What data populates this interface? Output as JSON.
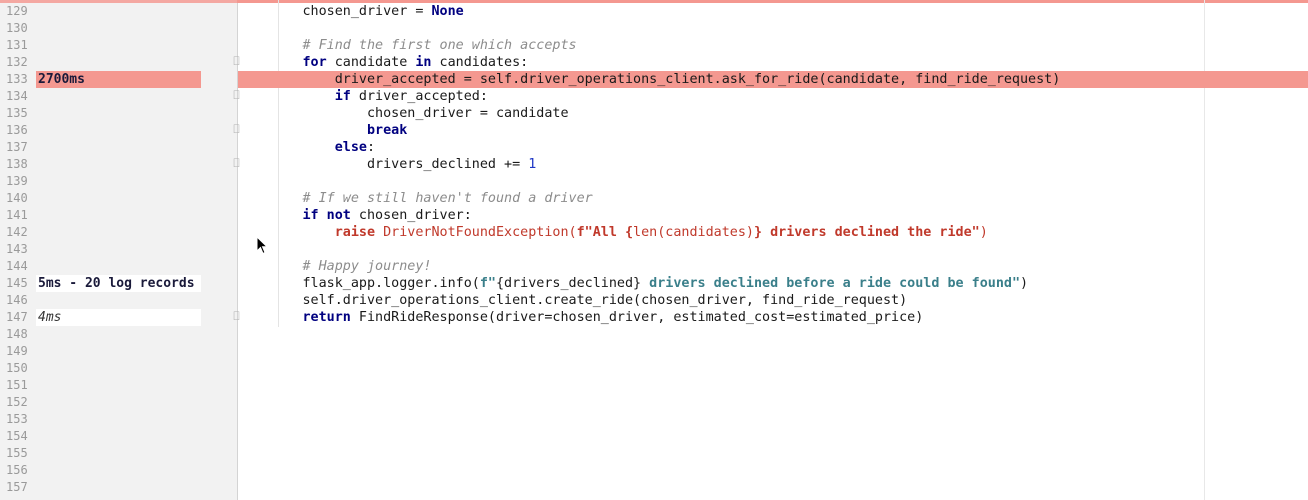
{
  "editor": {
    "lines": [
      {
        "n": "129",
        "annotation": "",
        "style": "",
        "tokens": [
          {
            "t": "        chosen_driver = ",
            "c": ""
          },
          {
            "t": "None",
            "c": "kw"
          }
        ]
      },
      {
        "n": "130",
        "annotation": "",
        "style": "",
        "tokens": []
      },
      {
        "n": "131",
        "annotation": "",
        "style": "",
        "tokens": [
          {
            "t": "        ",
            "c": ""
          },
          {
            "t": "# Find the first one which accepts",
            "c": "cm"
          }
        ]
      },
      {
        "n": "132",
        "annotation": "",
        "style": "",
        "fold": true,
        "tokens": [
          {
            "t": "        ",
            "c": ""
          },
          {
            "t": "for",
            "c": "kw"
          },
          {
            "t": " candidate ",
            "c": ""
          },
          {
            "t": "in",
            "c": "kw"
          },
          {
            "t": " candidates:",
            "c": ""
          }
        ]
      },
      {
        "n": "133",
        "annotation": "2700ms",
        "style": "bold",
        "hot": true,
        "tokens": [
          {
            "t": "            driver_accepted = self.driver_operations_client.ask_for_ride(candidate, find_ride_request)",
            "c": ""
          }
        ]
      },
      {
        "n": "134",
        "annotation": "",
        "style": "",
        "fold": true,
        "tokens": [
          {
            "t": "            ",
            "c": ""
          },
          {
            "t": "if",
            "c": "kw"
          },
          {
            "t": " driver_accepted:",
            "c": ""
          }
        ]
      },
      {
        "n": "135",
        "annotation": "",
        "style": "",
        "tokens": [
          {
            "t": "                chosen_driver = candidate",
            "c": ""
          }
        ]
      },
      {
        "n": "136",
        "annotation": "",
        "style": "",
        "fold": true,
        "tokens": [
          {
            "t": "                ",
            "c": ""
          },
          {
            "t": "break",
            "c": "kw"
          }
        ]
      },
      {
        "n": "137",
        "annotation": "",
        "style": "",
        "tokens": [
          {
            "t": "            ",
            "c": ""
          },
          {
            "t": "else",
            "c": "kw"
          },
          {
            "t": ":",
            "c": ""
          }
        ]
      },
      {
        "n": "138",
        "annotation": "",
        "style": "",
        "fold": true,
        "tokens": [
          {
            "t": "                drivers_declined += ",
            "c": ""
          },
          {
            "t": "1",
            "c": "num"
          }
        ]
      },
      {
        "n": "139",
        "annotation": "",
        "style": "",
        "tokens": []
      },
      {
        "n": "140",
        "annotation": "",
        "style": "",
        "tokens": [
          {
            "t": "        ",
            "c": ""
          },
          {
            "t": "# If we still haven't found a driver",
            "c": "cm"
          }
        ]
      },
      {
        "n": "141",
        "annotation": "",
        "style": "",
        "tokens": [
          {
            "t": "        ",
            "c": ""
          },
          {
            "t": "if not",
            "c": "kw"
          },
          {
            "t": " chosen_driver:",
            "c": ""
          }
        ]
      },
      {
        "n": "142",
        "annotation": "",
        "style": "",
        "tokens": [
          {
            "t": "            ",
            "c": ""
          },
          {
            "t": "raise",
            "c": "kw err"
          },
          {
            "t": " DriverNotFoundException(",
            "c": "err"
          },
          {
            "t": "f\"All {",
            "c": "err kw"
          },
          {
            "t": "len(candidates)",
            "c": "err"
          },
          {
            "t": "} drivers declined the ride\"",
            "c": "err kw"
          },
          {
            "t": ")",
            "c": "err"
          }
        ]
      },
      {
        "n": "143",
        "annotation": "",
        "style": "",
        "tokens": []
      },
      {
        "n": "144",
        "annotation": "",
        "style": "",
        "tokens": [
          {
            "t": "        ",
            "c": ""
          },
          {
            "t": "# Happy journey!",
            "c": "cm"
          }
        ]
      },
      {
        "n": "145",
        "annotation": "5ms - 20 log records",
        "style": "bold boxed",
        "tokens": [
          {
            "t": "        flask_app.logger.info(",
            "c": ""
          },
          {
            "t": "f\"",
            "c": "str"
          },
          {
            "t": "{drivers_declined}",
            "c": ""
          },
          {
            "t": " drivers declined before a ride could be found\"",
            "c": "str"
          },
          {
            "t": ")",
            "c": ""
          }
        ]
      },
      {
        "n": "146",
        "annotation": "",
        "style": "",
        "tokens": [
          {
            "t": "        self.driver_operations_client.create_ride(chosen_driver, find_ride_request)",
            "c": ""
          }
        ]
      },
      {
        "n": "147",
        "annotation": "4ms",
        "style": "italic boxed",
        "fold": true,
        "tokens": [
          {
            "t": "        ",
            "c": ""
          },
          {
            "t": "return",
            "c": "kw"
          },
          {
            "t": " FindRideResponse(driver=chosen_driver, estimated_cost=estimated_price)",
            "c": ""
          }
        ]
      },
      {
        "n": "148",
        "annotation": "",
        "style": "",
        "tokens": []
      },
      {
        "n": "149",
        "annotation": "",
        "style": "",
        "tokens": []
      },
      {
        "n": "150",
        "annotation": "",
        "style": "",
        "tokens": []
      },
      {
        "n": "151",
        "annotation": "",
        "style": "",
        "tokens": []
      },
      {
        "n": "152",
        "annotation": "",
        "style": "",
        "tokens": []
      },
      {
        "n": "153",
        "annotation": "",
        "style": "",
        "tokens": []
      },
      {
        "n": "154",
        "annotation": "",
        "style": "",
        "tokens": []
      },
      {
        "n": "155",
        "annotation": "",
        "style": "",
        "tokens": []
      },
      {
        "n": "156",
        "annotation": "",
        "style": "",
        "tokens": []
      },
      {
        "n": "157",
        "annotation": "",
        "style": "",
        "tokens": []
      }
    ]
  },
  "colors": {
    "hot_line": "#f49890",
    "keyword": "#000080",
    "comment": "#8c8c8c",
    "string": "#3a7f8a",
    "error": "#c0392b"
  },
  "icons": {
    "fold_marker": "fold-marker-icon",
    "cursor": "mouse-cursor-icon"
  }
}
